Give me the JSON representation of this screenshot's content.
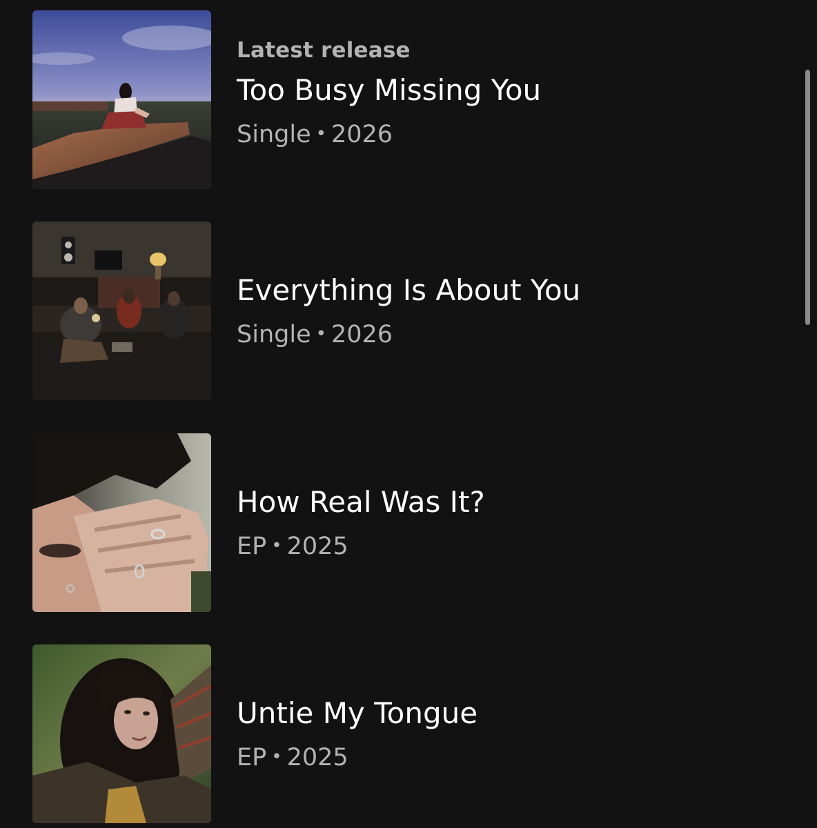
{
  "section": {
    "latest_label": "Latest release"
  },
  "releases": [
    {
      "title": "Too Busy Missing You",
      "type": "Single",
      "separator": "•",
      "year": "2026",
      "cover_icon": "album-cover-field-image"
    },
    {
      "title": "Everything Is About You",
      "type": "Single",
      "separator": "•",
      "year": "2026",
      "cover_icon": "album-cover-studio-image"
    },
    {
      "title": "How Real Was It?",
      "type": "EP",
      "separator": "•",
      "year": "2025",
      "cover_icon": "album-cover-portrait-hand-image"
    },
    {
      "title": "Untie My Tongue",
      "type": "EP",
      "separator": "•",
      "year": "2025",
      "cover_icon": "album-cover-portrait-hair-image"
    }
  ],
  "colors": {
    "background": "#121212",
    "primary_text": "#ffffff",
    "secondary_text": "#b3b3b3",
    "scrollbar": "#8a8a8a"
  }
}
